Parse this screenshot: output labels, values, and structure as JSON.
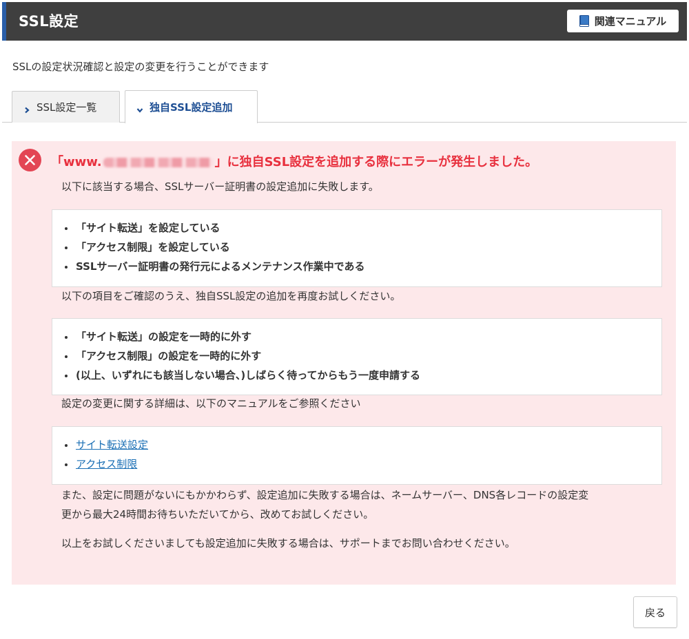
{
  "header": {
    "title": "SSL設定",
    "manual_button": "関連マニュアル",
    "manual_icon": "book-icon"
  },
  "intro": "SSLの設定状況確認と設定の変更を行うことができます",
  "tabs": [
    {
      "label": "SSL設定一覧",
      "icon": "chevron-right-icon",
      "active": false
    },
    {
      "label": "独自SSL設定追加",
      "icon": "chevron-down-icon",
      "active": true
    }
  ],
  "error": {
    "icon": "error-x-icon",
    "title_prefix": "「www.",
    "title_suffix": "」に独自SSL設定を追加する際にエラーが発生しました。",
    "line1": "以下に該当する場合、SSLサーバー証明書の設定追加に失敗します。",
    "causes": [
      "「サイト転送」を設定している",
      "「アクセス制限」を設定している",
      "SSLサーバー証明書の発行元によるメンテナンス作業中である"
    ],
    "line2": "以下の項目をご確認のうえ、独自SSL設定の追加を再度お試しください。",
    "actions": [
      "「サイト転送」の設定を一時的に外す",
      "「アクセス制限」の設定を一時的に外す",
      "(以上、いずれにも該当しない場合、)しばらく待ってからもう一度申請する"
    ],
    "line3": "設定の変更に関する詳細は、以下のマニュアルをご参照ください",
    "links": [
      "サイト転送設定",
      "アクセス制限"
    ],
    "note1_a": "また、設定に問題がないにもかかわらず、設定追加に失敗する場合は、ネームサーバー、DNS各レコードの設定変",
    "note1_b": "更から最大24時間お待ちいただいてから、改めてお試しください。",
    "note2": "以上をお試しくださいましても設定追加に失敗する場合は、サポートまでお問い合わせください。"
  },
  "back_button": "戻る",
  "colors": {
    "header_bg": "#3f3f3f",
    "header_accent": "#2a5ea8",
    "error_bg": "#fde8ea",
    "error_text": "#e8303e",
    "link": "#1a6fb5",
    "active_tab_text": "#1e4f94"
  }
}
